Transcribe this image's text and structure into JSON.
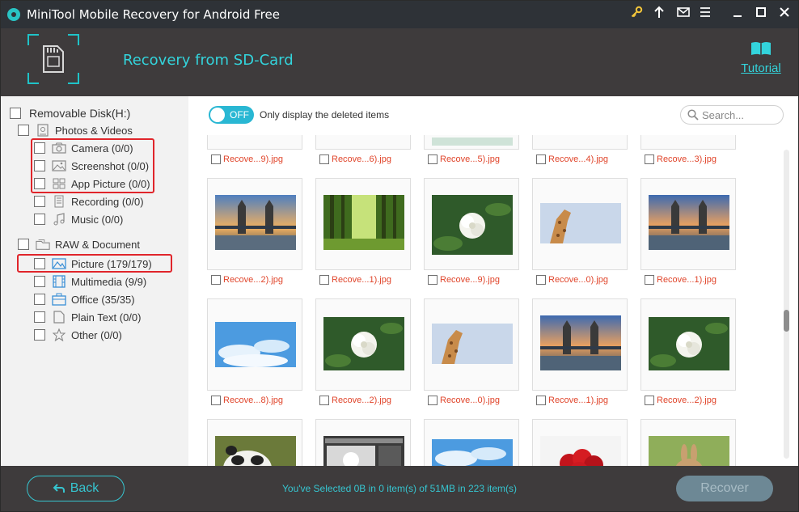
{
  "window": {
    "title": "MiniTool Mobile Recovery for Android Free",
    "titlebar_icons": [
      "key-icon",
      "upgrade-arrow-icon",
      "mail-icon",
      "menu-icon",
      "minimize-icon",
      "maximize-icon",
      "close-icon"
    ]
  },
  "header": {
    "heading": "Recovery from SD-Card",
    "tutorial_label": "Tutorial"
  },
  "sidebar": {
    "root": {
      "label": "Removable Disk(H:)"
    },
    "groups": [
      {
        "label": "Photos & Videos",
        "items": [
          {
            "label": "Camera (0/0)",
            "icon": "camera-icon"
          },
          {
            "label": "Screenshot (0/0)",
            "icon": "screenshot-icon"
          },
          {
            "label": "App Picture (0/0)",
            "icon": "app-picture-icon"
          },
          {
            "label": "Recording (0/0)",
            "icon": "recording-icon"
          },
          {
            "label": "Music (0/0)",
            "icon": "music-icon"
          }
        ]
      },
      {
        "label": "RAW & Document",
        "items": [
          {
            "label": "Picture (179/179)",
            "icon": "picture-icon"
          },
          {
            "label": "Multimedia (9/9)",
            "icon": "multimedia-icon"
          },
          {
            "label": "Office (35/35)",
            "icon": "office-icon"
          },
          {
            "label": "Plain Text (0/0)",
            "icon": "plain-text-icon"
          },
          {
            "label": "Other (0/0)",
            "icon": "other-star-icon"
          }
        ]
      }
    ]
  },
  "toolbar": {
    "toggle_state": "OFF",
    "toggle_label": "Only display the deleted items",
    "search_placeholder": "Search..."
  },
  "files": {
    "row0": [
      "Recove...9).jpg",
      "Recove...6).jpg",
      "Recove...5).jpg",
      "Recove...4).jpg",
      "Recove...3).jpg"
    ],
    "row1": [
      "Recove...2).jpg",
      "Recove...1).jpg",
      "Recove...9).jpg",
      "Recove...0).jpg",
      "Recove...1).jpg"
    ],
    "row2": [
      "Recove...8).jpg",
      "Recove...2).jpg",
      "Recove...0).jpg",
      "Recove...1).jpg",
      "Recove...2).jpg"
    ],
    "thumbnails": {
      "row1": [
        "tower-bridge",
        "forest",
        "white-flower",
        "giraffe",
        "tower-bridge"
      ],
      "row2": [
        "sky-clouds",
        "white-flower",
        "giraffe",
        "tower-bridge",
        "white-flower"
      ],
      "row3": [
        "panda",
        "screenshot",
        "sky-clouds",
        "red-roses",
        "rabbit"
      ]
    }
  },
  "footer": {
    "back_label": "Back",
    "status": "You've Selected 0B in 0 item(s) of 51MB in 223 item(s)",
    "recover_label": "Recover"
  },
  "colors": {
    "accent": "#33d4dc",
    "titlebar": "#2e3237",
    "panel": "#3e3b3c",
    "highlight": "#e0252b",
    "filename": "#e0452b"
  }
}
